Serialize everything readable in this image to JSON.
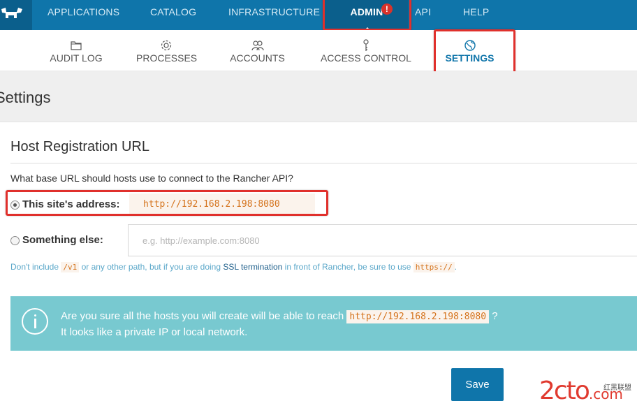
{
  "topnav": {
    "items": [
      "APPLICATIONS",
      "CATALOG",
      "INFRASTRUCTURE",
      "ADMIN",
      "API",
      "HELP"
    ],
    "active": "ADMIN",
    "badge": "!",
    "color": "#0f75aa"
  },
  "subnav": {
    "items": [
      {
        "label": "AUDIT LOG",
        "icon": "folder-icon"
      },
      {
        "label": "PROCESSES",
        "icon": "gear-icon"
      },
      {
        "label": "ACCOUNTS",
        "icon": "users-icon"
      },
      {
        "label": "ACCESS CONTROL",
        "icon": "key-icon"
      },
      {
        "label": "SETTINGS",
        "icon": "globe-icon"
      }
    ],
    "active": "SETTINGS"
  },
  "page": {
    "title": "Settings"
  },
  "host_registration": {
    "title": "Host Registration URL",
    "question": "What base URL should hosts use to connect to the Rancher API?",
    "option_site": {
      "label": "This site's address:",
      "value": "http://192.168.2.198:8080",
      "checked": true
    },
    "option_else": {
      "label": "Something else:",
      "placeholder": "e.g. http://example.com:8080",
      "checked": false
    },
    "hint": {
      "part1": "Don't include",
      "code1": "/v1",
      "part2": "or any other path, but if you are doing",
      "link": "SSL termination",
      "part3": "in front of Rancher, be sure to use",
      "code2": "https://",
      "part4": "."
    }
  },
  "alert": {
    "line1_prefix": "Are you sure all the hosts you will create will be able to reach",
    "url": "http://192.168.2.198:8080",
    "line1_suffix": "?",
    "line2": "It looks like a private IP or local network.",
    "color": "#78c9d0"
  },
  "actions": {
    "save_label": "Save"
  },
  "watermark": {
    "text": "2cto",
    "suffix": ".com",
    "small": "红黑联盟"
  }
}
